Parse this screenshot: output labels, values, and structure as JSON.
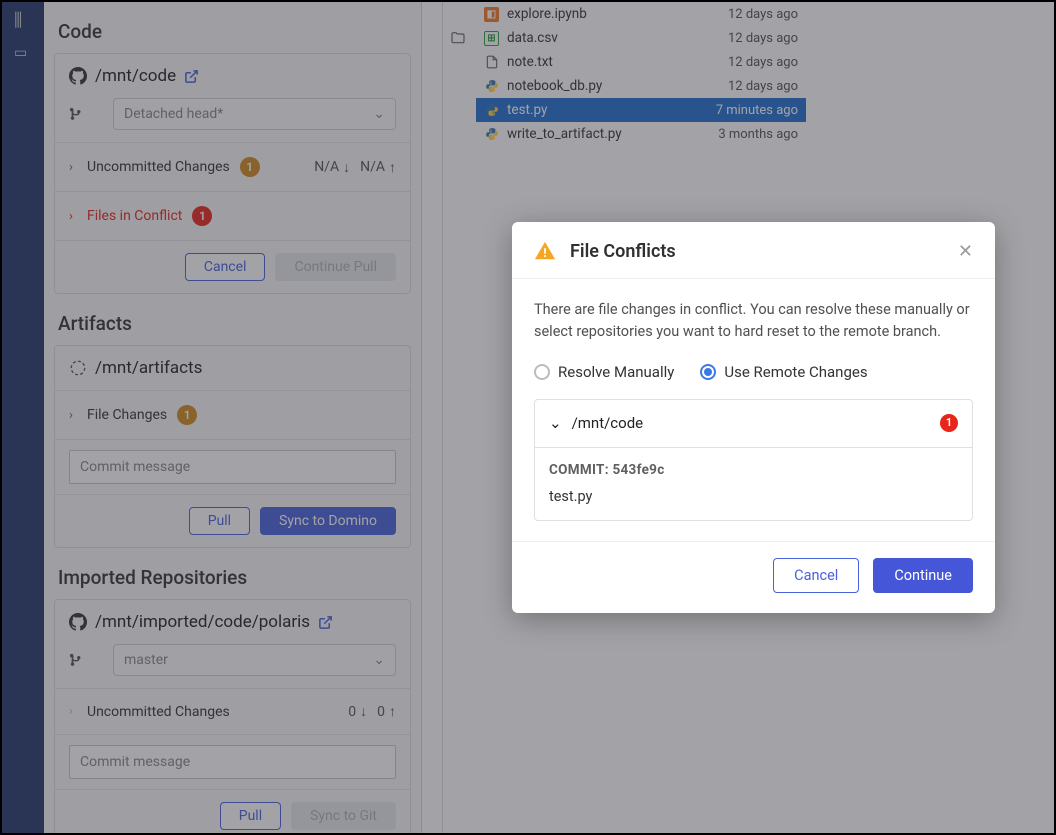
{
  "panel": {
    "code_heading": "Code",
    "code_repo_path": "/mnt/code",
    "code_branch": "Detached head*",
    "uncommitted_label": "Uncommitted Changes",
    "uncommitted_count": "1",
    "down_na": "N/A",
    "up_na": "N/A",
    "conflict_label": "Files in Conflict",
    "conflict_count": "1",
    "cancel_label": "Cancel",
    "continue_pull_label": "Continue Pull",
    "artifacts_heading": "Artifacts",
    "artifacts_path": "/mnt/artifacts",
    "file_changes_label": "File Changes",
    "file_changes_count": "1",
    "commit_placeholder": "Commit message",
    "pull_label": "Pull",
    "sync_domino_label": "Sync to Domino",
    "imported_heading": "Imported Repositories",
    "imported_path": "/mnt/imported/code/polaris",
    "imported_branch": "master",
    "imported_uncommitted_label": "Uncommitted Changes",
    "imported_down": "0",
    "imported_up": "0",
    "sync_git_label": "Sync to Git"
  },
  "files": [
    {
      "icon": "jup",
      "name": "explore.ipynb",
      "ago": "12 days ago",
      "selected": false
    },
    {
      "icon": "csv",
      "name": "data.csv",
      "ago": "12 days ago",
      "selected": false
    },
    {
      "icon": "txt",
      "name": "note.txt",
      "ago": "12 days ago",
      "selected": false
    },
    {
      "icon": "py",
      "name": "notebook_db.py",
      "ago": "12 days ago",
      "selected": false
    },
    {
      "icon": "py",
      "name": "test.py",
      "ago": "7 minutes ago",
      "selected": true
    },
    {
      "icon": "py",
      "name": "write_to_artifact.py",
      "ago": "3 months ago",
      "selected": false
    }
  ],
  "modal": {
    "title": "File Conflicts",
    "description": "There are file changes in conflict. You can resolve these manually or select repositories you want to hard reset to the remote branch.",
    "radio_manual": "Resolve Manually",
    "radio_remote": "Use Remote Changes",
    "repo_path": "/mnt/code",
    "repo_conflict_count": "1",
    "commit_label": "COMMIT: 543fe9c",
    "conflict_file": "test.py",
    "cancel_label": "Cancel",
    "continue_label": "Continue"
  }
}
